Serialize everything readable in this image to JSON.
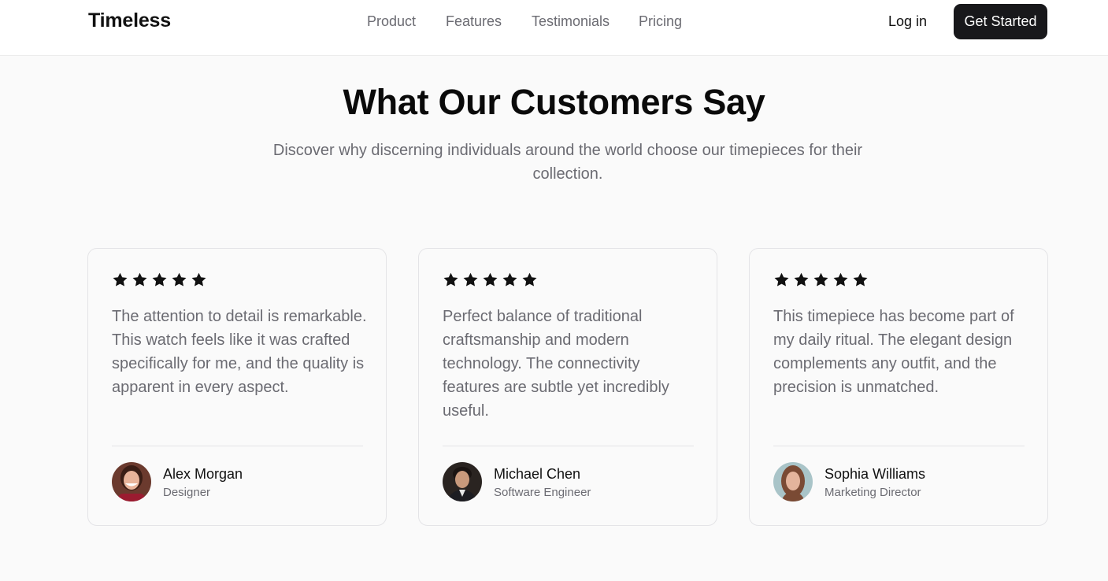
{
  "nav": {
    "brand": "Timeless",
    "links": [
      {
        "label": "Product"
      },
      {
        "label": "Features"
      },
      {
        "label": "Testimonials"
      },
      {
        "label": "Pricing"
      }
    ],
    "login_label": "Log in",
    "cta_label": "Get Started"
  },
  "section": {
    "title": "What Our Customers Say",
    "subtitle": "Discover why discerning individuals around the world choose our timepieces for their collection."
  },
  "testimonials": [
    {
      "rating": 5,
      "quote": "The attention to detail is remarkable. This watch feels like it was crafted specifically for me, and the quality is apparent in every aspect.",
      "name": "Alex Morgan",
      "role": "Designer"
    },
    {
      "rating": 5,
      "quote": "Perfect balance of traditional craftsmanship and modern technology. The connectivity features are subtle yet incredibly useful.",
      "name": "Michael Chen",
      "role": "Software Engineer"
    },
    {
      "rating": 5,
      "quote": "This timepiece has become part of my daily ritual. The elegant design complements any outfit, and the precision is unmatched.",
      "name": "Sophia Williams",
      "role": "Marketing Director"
    }
  ],
  "colors": {
    "background": "#fafafa",
    "text_primary": "#111111",
    "text_muted": "#6b6b72",
    "button_dark": "#18181b",
    "border": "#e4e4e7"
  },
  "icons": {
    "rating": "star-icon",
    "avatar": "person-photo"
  }
}
